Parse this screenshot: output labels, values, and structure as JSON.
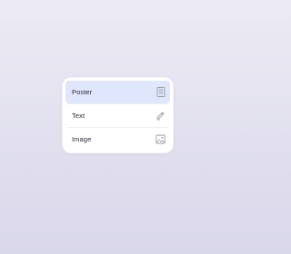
{
  "menu": {
    "items": [
      {
        "label": "Poster",
        "icon": "document-icon",
        "selected": true
      },
      {
        "label": "Text",
        "icon": "pen-icon",
        "selected": false
      },
      {
        "label": "Image",
        "icon": "image-icon",
        "selected": false
      }
    ]
  },
  "colors": {
    "background_top": "#ecebf4",
    "background_bottom": "#d9d7ea",
    "selected_item": "#e0e6fb",
    "icon": "#9a9aa6",
    "label": "#2b2b38"
  }
}
